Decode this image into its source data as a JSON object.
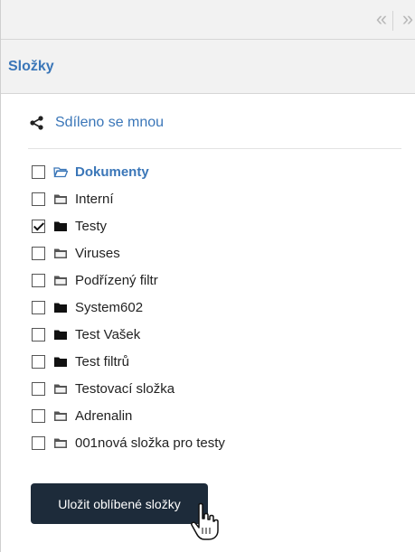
{
  "toolbar": {
    "collapse_left_icon": "«",
    "collapse_right_icon": "»"
  },
  "header": {
    "title": "Složky"
  },
  "shared": {
    "label": "Sdíleno se mnou",
    "icon": "share-icon"
  },
  "folders": [
    {
      "label": "Dokumenty",
      "checked": false,
      "icon": "folder-open-icon",
      "bold": true
    },
    {
      "label": "Interní",
      "checked": false,
      "icon": "folder-icon"
    },
    {
      "label": "Testy",
      "checked": true,
      "icon": "folder-dark-icon"
    },
    {
      "label": "Viruses",
      "checked": false,
      "icon": "folder-icon"
    },
    {
      "label": "Podřízený filtr",
      "checked": false,
      "icon": "folder-icon"
    },
    {
      "label": "System602",
      "checked": false,
      "icon": "folder-dark-icon"
    },
    {
      "label": "Test Vašek",
      "checked": false,
      "icon": "folder-dark-icon"
    },
    {
      "label": "Test filtrů",
      "checked": false,
      "icon": "folder-dark-icon"
    },
    {
      "label": "Testovací složka",
      "checked": false,
      "icon": "folder-icon"
    },
    {
      "label": "Adrenalin",
      "checked": false,
      "icon": "folder-icon"
    },
    {
      "label": "001nová složka pro testy",
      "checked": false,
      "icon": "folder-icon"
    }
  ],
  "save_button": {
    "label": "Uložit oblíbené složky"
  },
  "colors": {
    "accent": "#3a76b8",
    "button_bg": "#1d2b3a"
  }
}
